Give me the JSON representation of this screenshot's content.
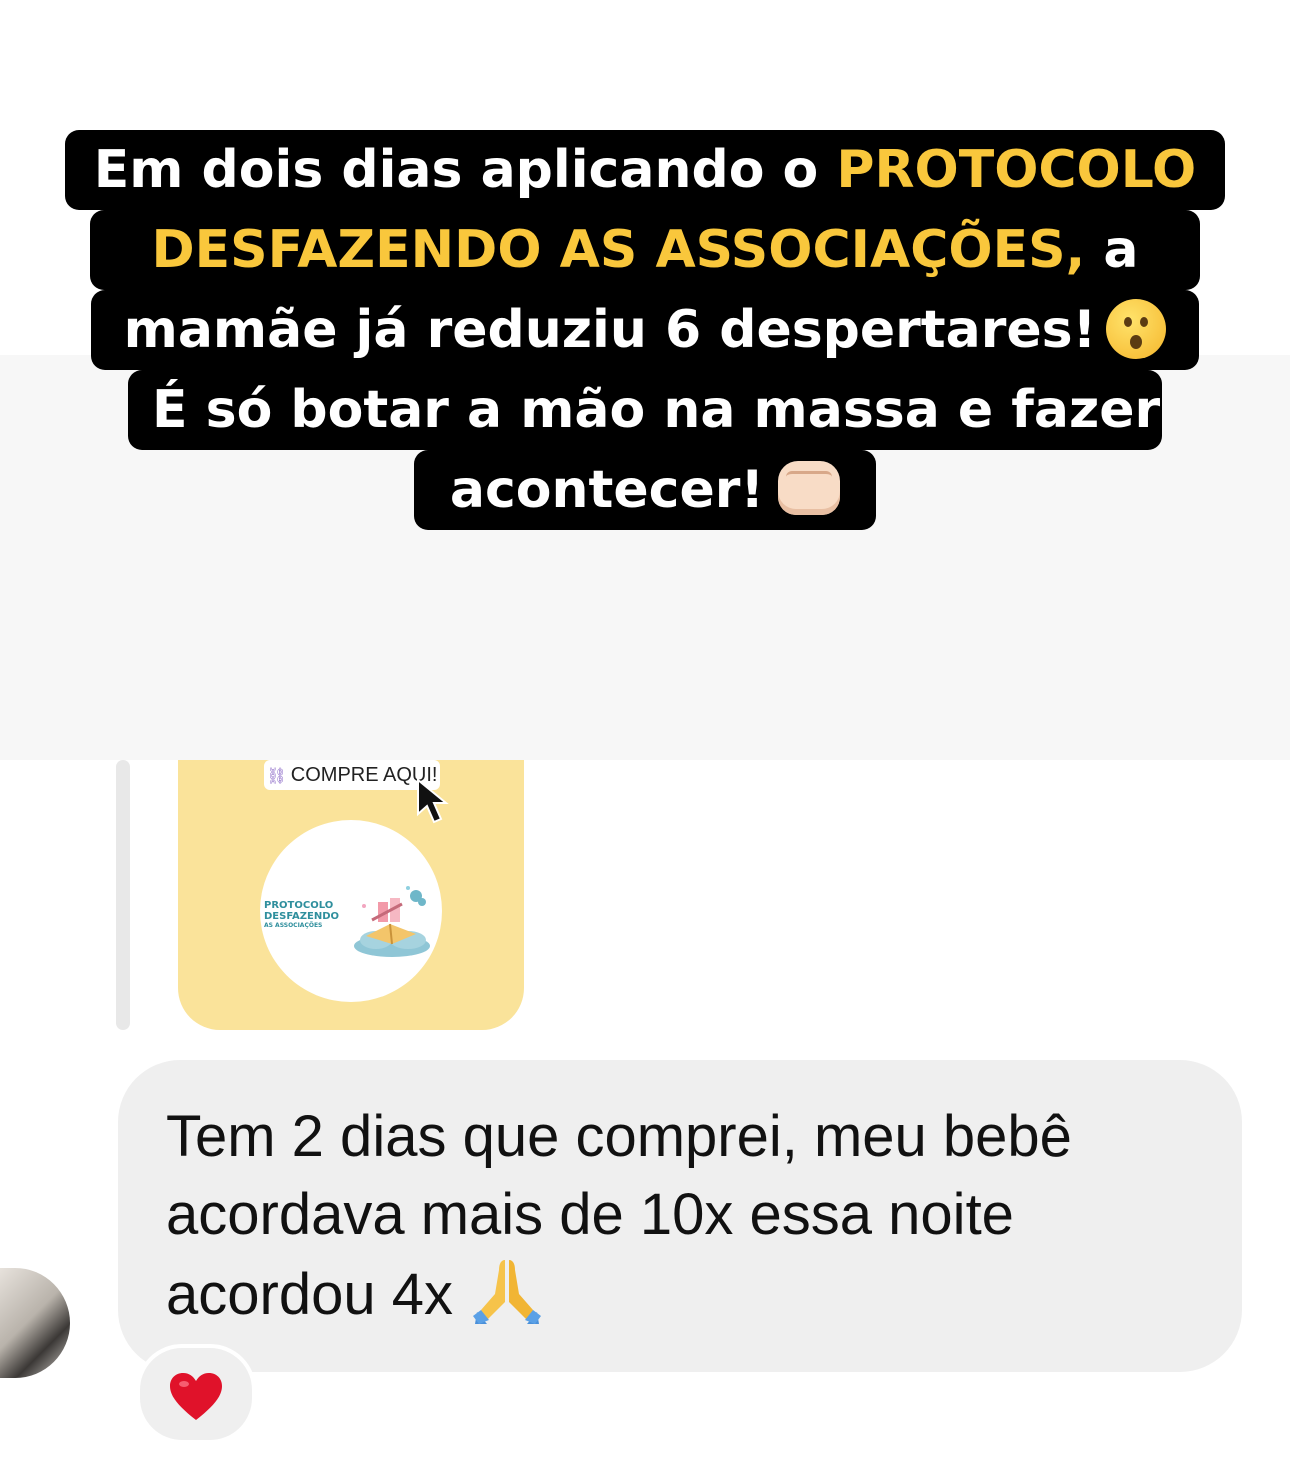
{
  "caption": {
    "line1_text": "Em dois dias aplicando o ",
    "line1_highlight": "PROTOCOLO",
    "line2_highlight": "DESFAZENDO AS ASSOCIAÇÕES,",
    "line2_text": " a",
    "line3_text": "mamãe já reduziu 6 despertares!",
    "line4_text": "É só botar a mão na massa e fazer",
    "line5_text": "acontecer!",
    "highlight_color": "#f9c73c",
    "emoji_line3": "astonished-face",
    "emoji_line5": "fist-bump"
  },
  "story_reply": {
    "sticker_label": "COMPRE AQUI!",
    "product_name_1": "PROTOCOLO",
    "product_name_2": "DESFAZENDO",
    "product_name_3": "AS ASSOCIAÇÕES",
    "card_color": "#fae39a"
  },
  "message": {
    "text": "Tem 2 dias que comprei,  meu bebê\nacordava mais de 10x essa noite\nacordou 4x",
    "emoji": "folded-hands",
    "reaction": "red-heart"
  }
}
